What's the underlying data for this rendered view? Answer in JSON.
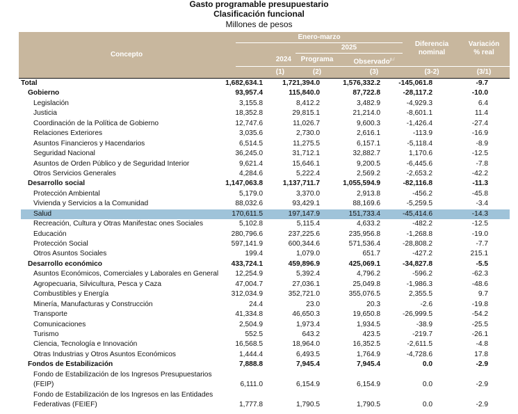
{
  "title": "Gasto programable presupuestario",
  "subtitle": "Clasificación funcional",
  "units": "Millones de pesos",
  "header": {
    "concepto": "Concepto",
    "period": "Enero-marzo",
    "year2025": "2025",
    "col_2024": "2024",
    "col_programa": "Programa",
    "col_observado": "Observado",
    "observado_sup": "p./",
    "col_diff_1": "Diferencia",
    "col_diff_2": "nominal",
    "col_var_1": "Variación",
    "col_var_2": "% real",
    "n1": "(1)",
    "n2": "(2)",
    "n3": "(3)",
    "n4": "(3-2)",
    "n5": "(3/1)"
  },
  "rows": [
    {
      "label": "Total",
      "level": 0,
      "bold": true,
      "v": [
        "1,682,634.1",
        "1,721,394.0",
        "1,576,332.2",
        "-145,061.8",
        "-9.7"
      ]
    },
    {
      "label": "Gobierno",
      "level": 1,
      "bold": true,
      "v": [
        "93,957.4",
        "115,840.0",
        "87,722.8",
        "-28,117.2",
        "-10.0"
      ]
    },
    {
      "label": "Legislación",
      "level": 2,
      "v": [
        "3,155.8",
        "8,412.2",
        "3,482.9",
        "-4,929.3",
        "6.4"
      ]
    },
    {
      "label": "Justicia",
      "level": 2,
      "v": [
        "18,352.8",
        "29,815.1",
        "21,214.0",
        "-8,601.1",
        "11.4"
      ]
    },
    {
      "label": "Coordinación de la Política de Gobierno",
      "level": 2,
      "v": [
        "12,747.6",
        "11,026.7",
        "9,600.3",
        "-1,426.4",
        "-27.4"
      ]
    },
    {
      "label": "Relaciones Exteriores",
      "level": 2,
      "v": [
        "3,035.6",
        "2,730.0",
        "2,616.1",
        "-113.9",
        "-16.9"
      ]
    },
    {
      "label": "Asuntos Financieros y Hacendarios",
      "level": 2,
      "v": [
        "6,514.5",
        "11,275.5",
        "6,157.1",
        "-5,118.4",
        "-8.9"
      ]
    },
    {
      "label": "Seguridad Nacional",
      "level": 2,
      "v": [
        "36,245.0",
        "31,712.1",
        "32,882.7",
        "1,170.6",
        "-12.5"
      ]
    },
    {
      "label": "Asuntos de Orden Público y de Seguridad Interior",
      "level": 2,
      "v": [
        "9,621.4",
        "15,646.1",
        "9,200.5",
        "-6,445.6",
        "-7.8"
      ]
    },
    {
      "label": "Otros Servicios Generales",
      "level": 2,
      "v": [
        "4,284.6",
        "5,222.4",
        "2,569.2",
        "-2,653.2",
        "-42.2"
      ]
    },
    {
      "label": "Desarrollo social",
      "level": 1,
      "bold": true,
      "v": [
        "1,147,063.8",
        "1,137,711.7",
        "1,055,594.9",
        "-82,116.8",
        "-11.3"
      ]
    },
    {
      "label": "Protección Ambiental",
      "level": 2,
      "v": [
        "5,179.0",
        "3,370.0",
        "2,913.8",
        "-456.2",
        "-45.8"
      ]
    },
    {
      "label": "Vivienda y Servicios a la Comunidad",
      "level": 2,
      "v": [
        "88,032.6",
        "93,429.1",
        "88,169.6",
        "-5,259.5",
        "-3.4"
      ]
    },
    {
      "label": "Salud",
      "level": 2,
      "highlight": true,
      "v": [
        "170,611.5",
        "197,147.9",
        "151,733.4",
        "-45,414.6",
        "-14.3"
      ]
    },
    {
      "label": "Recreación, Cultura y Otras Manifestac ones Sociales",
      "level": 2,
      "v": [
        "5,102.8",
        "5,115.4",
        "4,633.2",
        "-482.2",
        "-12.5"
      ]
    },
    {
      "label": "Educación",
      "level": 2,
      "v": [
        "280,796.6",
        "237,225.6",
        "235,956.8",
        "-1,268.8",
        "-19.0"
      ]
    },
    {
      "label": "Protección Social",
      "level": 2,
      "v": [
        "597,141.9",
        "600,344.6",
        "571,536.4",
        "-28,808.2",
        "-7.7"
      ]
    },
    {
      "label": "Otros Asuntos Sociales",
      "level": 2,
      "v": [
        "199.4",
        "1,079.0",
        "651.7",
        "-427.2",
        "215.1"
      ]
    },
    {
      "label": "Desarrollo económico",
      "level": 1,
      "bold": true,
      "v": [
        "433,724.1",
        "459,896.9",
        "425,069.1",
        "-34,827.8",
        "-5.5"
      ]
    },
    {
      "label": "Asuntos Económicos, Comerciales y Laborales en General",
      "level": 2,
      "v": [
        "12,254.9",
        "5,392.4",
        "4,796.2",
        "-596.2",
        "-62.3"
      ]
    },
    {
      "label": "Agropecuaria, Silvicultura, Pesca y Caza",
      "level": 2,
      "v": [
        "47,004.7",
        "27,036.1",
        "25,049.8",
        "-1,986.3",
        "-48.6"
      ]
    },
    {
      "label": "Combustibles y Energía",
      "level": 2,
      "v": [
        "312,034.9",
        "352,721.0",
        "355,076.5",
        "2,355.5",
        "9.7"
      ]
    },
    {
      "label": "Minería, Manufacturas y Construcción",
      "level": 2,
      "v": [
        "24.4",
        "23.0",
        "20.3",
        "-2.6",
        "-19.8"
      ]
    },
    {
      "label": "Transporte",
      "level": 2,
      "v": [
        "41,334.8",
        "46,650.3",
        "19,650.8",
        "-26,999.5",
        "-54.2"
      ]
    },
    {
      "label": "Comunicaciones",
      "level": 2,
      "v": [
        "2,504.9",
        "1,973.4",
        "1,934.5",
        "-38.9",
        "-25.5"
      ]
    },
    {
      "label": "Turismo",
      "level": 2,
      "v": [
        "552.5",
        "643.2",
        "423.5",
        "-219.7",
        "-26.1"
      ]
    },
    {
      "label": "Ciencia, Tecnología e Innovación",
      "level": 2,
      "v": [
        "16,568.5",
        "18,964.0",
        "16,352.5",
        "-2,611.5",
        "-4.8"
      ]
    },
    {
      "label": "Otras Industrias y Otros Asuntos Económicos",
      "level": 2,
      "v": [
        "1,444.4",
        "6,493.5",
        "1,764.9",
        "-4,728.6",
        "17.8"
      ]
    },
    {
      "label": "Fondos de Estabilización",
      "level": 1,
      "bold": true,
      "v": [
        "7,888.8",
        "7,945.4",
        "7,945.4",
        "0.0",
        "-2.9"
      ]
    },
    {
      "label": "Fondo de Estabilización de los Ingresos Presupuestarios (FEIP)",
      "label_line1": "Fondo de Estabilización de los Ingresos Presupuestarios",
      "label_line2": "(FEIP)",
      "level": 2,
      "tall": true,
      "v": [
        "6,111.0",
        "6,154.9",
        "6,154.9",
        "0.0",
        "-2.9"
      ]
    },
    {
      "label": "Fondo de Estabilización de los Ingresos en las Entidades Federativas (FEIEF)",
      "label_line1": "Fondo de Estabilización de los Ingresos en las Entidades",
      "label_line2": "Federativas (FEIEF)",
      "level": 2,
      "tall": true,
      "v": [
        "1,777.8",
        "1,790.5",
        "1,790.5",
        "0.0",
        "-2.9"
      ]
    }
  ]
}
